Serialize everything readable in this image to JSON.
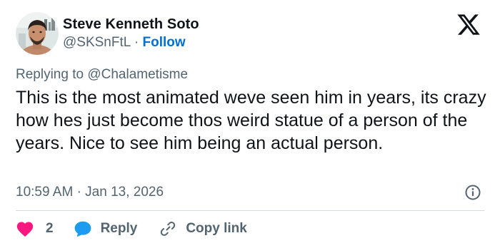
{
  "author": {
    "name": "Steve Kenneth Soto",
    "handle": "@SKSnFtL",
    "separator": "·",
    "follow_label": "Follow",
    "avatar_icon": "profile-photo"
  },
  "logo": {
    "icon": "x-logo-icon"
  },
  "reply_context": "Replying to @Chalametisme",
  "tweet": {
    "text": "This is the most animated weve seen him in years, its crazy how hes just become thos weird statue of a person of the years. Nice to see him being an actual person."
  },
  "meta": {
    "time": "10:59 AM",
    "separator": "·",
    "date": "Jan 13, 2026",
    "info_icon": "info-icon"
  },
  "actions": {
    "like_count": "2",
    "reply_label": "Reply",
    "copy_label": "Copy link"
  },
  "colors": {
    "text": "#0f1419",
    "secondary": "#536471",
    "follow": "#006fd6",
    "like": "#f91880",
    "reply": "#1d9bf0",
    "divider": "#cfd9de"
  }
}
